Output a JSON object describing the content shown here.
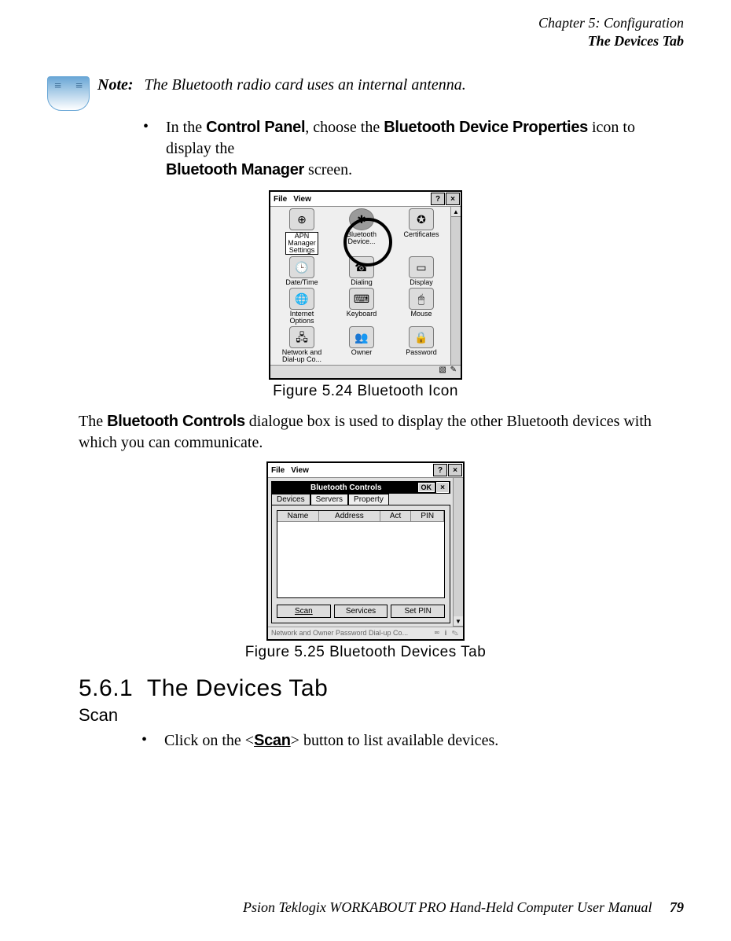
{
  "header": {
    "chapter": "Chapter 5: Configuration",
    "section": "The Devices Tab"
  },
  "note": {
    "label": "Note:",
    "text": "The Bluetooth radio card uses an internal antenna."
  },
  "bullet1": {
    "pre": "In the ",
    "b1": "Control Panel",
    "mid": ", choose the ",
    "b2": "Bluetooth Device Properties",
    "post": " icon to display the ",
    "b3": "Bluetooth Manager",
    "end": " screen."
  },
  "cp": {
    "menu_file": "File",
    "menu_view": "View",
    "help": "?",
    "close": "×",
    "items": [
      {
        "label": "APN\nManager\nSettings",
        "boxed": true
      },
      {
        "label": "Bluetooth\nDevice..."
      },
      {
        "label": "Certificates"
      },
      {
        "label": "Date/Time"
      },
      {
        "label": "Dialing"
      },
      {
        "label": "Display"
      },
      {
        "label": "Internet\nOptions"
      },
      {
        "label": "Keyboard"
      },
      {
        "label": "Mouse"
      },
      {
        "label": "Network and\nDial-up Co..."
      },
      {
        "label": "Owner"
      },
      {
        "label": "Password"
      }
    ]
  },
  "fig1_caption": "Figure 5.24 Bluetooth Icon",
  "para2": {
    "pre": "The ",
    "b1": "Bluetooth Controls",
    "post": " dialogue box is used to display the other Bluetooth devices with which you can communicate."
  },
  "bt": {
    "outer_file": "File",
    "outer_view": "View",
    "outer_help": "?",
    "outer_close": "×",
    "title": "Bluetooth Controls",
    "ok": "OK",
    "close": "×",
    "tabs": {
      "devices": "Devices",
      "servers": "Servers",
      "property": "Property"
    },
    "cols": {
      "name": "Name",
      "address": "Address",
      "act": "Act",
      "pin": "PIN"
    },
    "buttons": {
      "scan": "Scan",
      "services": "Services",
      "setpin": "Set PIN"
    },
    "footer": {
      "left": "Network and   Owner   Password\nDial-up Co..."
    }
  },
  "fig2_caption": "Figure 5.25 Bluetooth Devices Tab",
  "section": {
    "num": "5.6.1",
    "title": "The Devices Tab"
  },
  "subsection": "Scan",
  "bullet2": {
    "pre": "Click on the <",
    "b1": "Scan",
    "post": "> button to list available devices."
  },
  "footer": {
    "text": "Psion Teklogix WORKABOUT PRO Hand-Held Computer User Manual",
    "page": "79"
  }
}
